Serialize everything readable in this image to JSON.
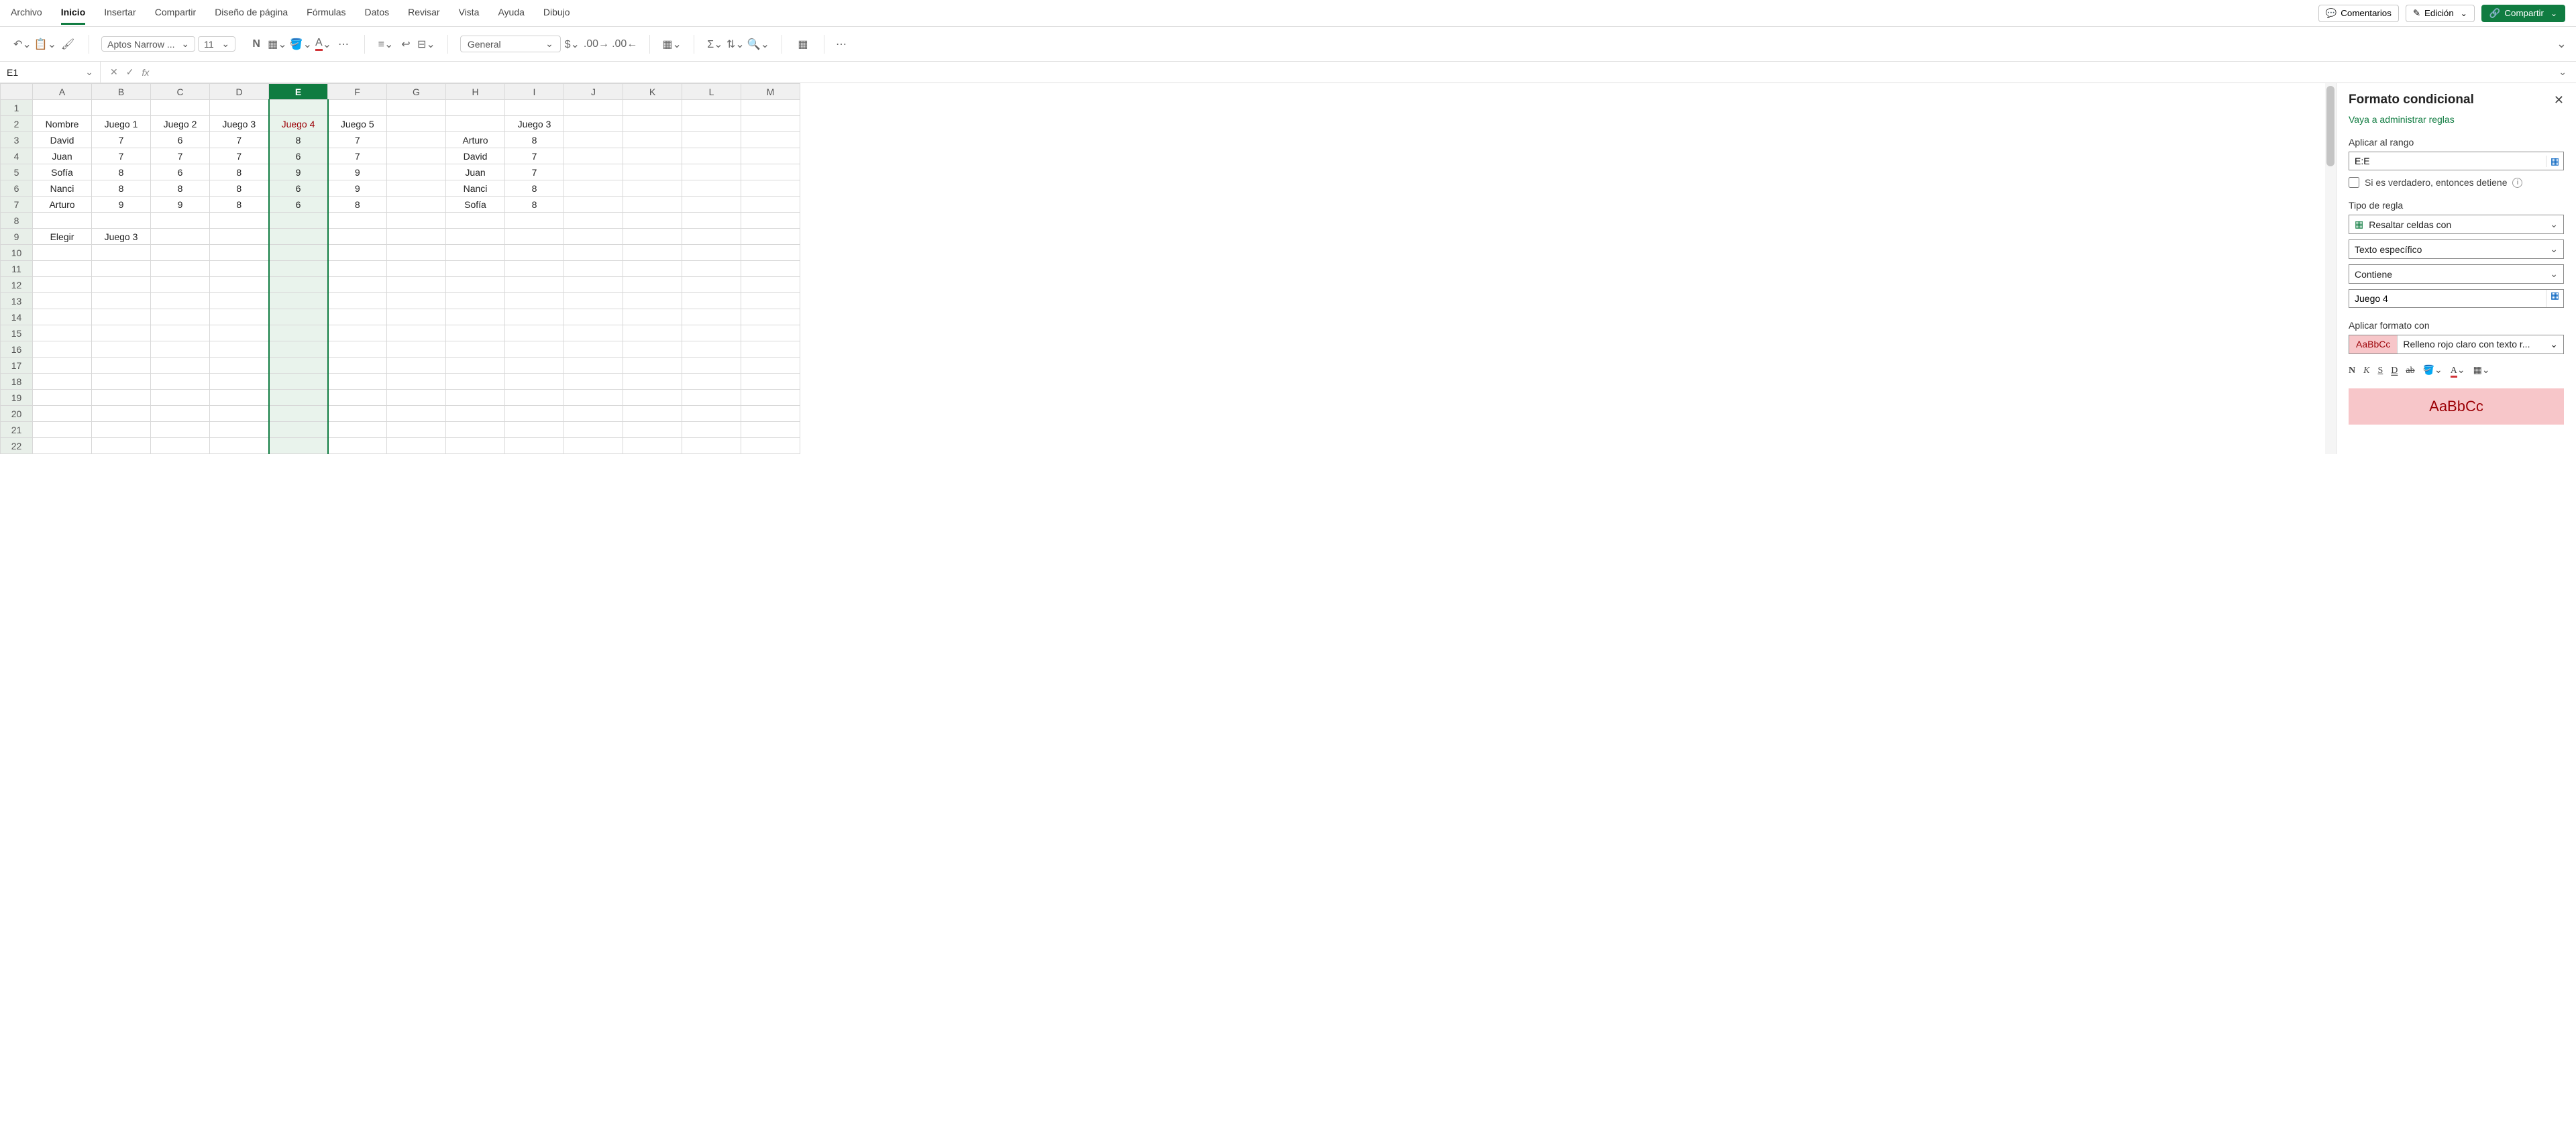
{
  "menu": {
    "items": [
      "Archivo",
      "Inicio",
      "Insertar",
      "Compartir",
      "Diseño de página",
      "Fórmulas",
      "Datos",
      "Revisar",
      "Vista",
      "Ayuda",
      "Dibujo"
    ],
    "active_index": 1,
    "comments": "Comentarios",
    "editing": "Edición",
    "share": "Compartir"
  },
  "ribbon": {
    "font_name": "Aptos Narrow ...",
    "font_size": "11",
    "number_format": "General"
  },
  "name_box": "E1",
  "formula": "",
  "grid": {
    "columns": [
      "A",
      "B",
      "C",
      "D",
      "E",
      "F",
      "G",
      "H",
      "I",
      "J",
      "K",
      "L",
      "M"
    ],
    "selected_column": "E",
    "row_count": 22,
    "highlight": {
      "r": 2,
      "c": "E"
    },
    "cells": {
      "2": {
        "A": "Nombre",
        "B": "Juego 1",
        "C": "Juego 2",
        "D": "Juego 3",
        "E": "Juego 4",
        "F": "Juego 5",
        "H": "",
        "I": "Juego 3"
      },
      "3": {
        "A": "David",
        "B": "7",
        "C": "6",
        "D": "7",
        "E": "8",
        "F": "7",
        "H": "Arturo",
        "I": "8"
      },
      "4": {
        "A": "Juan",
        "B": "7",
        "C": "7",
        "D": "7",
        "E": "6",
        "F": "7",
        "H": "David",
        "I": "7"
      },
      "5": {
        "A": "Sofía",
        "B": "8",
        "C": "6",
        "D": "8",
        "E": "9",
        "F": "9",
        "H": "Juan",
        "I": "7"
      },
      "6": {
        "A": "Nanci",
        "B": "8",
        "C": "8",
        "D": "8",
        "E": "6",
        "F": "9",
        "H": "Nanci",
        "I": "8"
      },
      "7": {
        "A": "Arturo",
        "B": "9",
        "C": "9",
        "D": "8",
        "E": "6",
        "F": "8",
        "H": "Sofía",
        "I": "8"
      },
      "9": {
        "A": "Elegir",
        "B": "Juego 3"
      }
    }
  },
  "panel": {
    "title": "Formato condicional",
    "manage_link": "Vaya a administrar reglas",
    "apply_range_label": "Aplicar al rango",
    "apply_range_value": "E:E",
    "stop_if_true": "Si es verdadero, entonces detiene",
    "rule_type_label": "Tipo de regla",
    "rule_type_value": "Resaltar celdas con",
    "subrule1": "Texto específico",
    "subrule2": "Contiene",
    "text_value": "Juego 4",
    "apply_format_label": "Aplicar formato con",
    "swatch_text": "AaBbCc",
    "format_preset": "Relleno rojo claro con texto r...",
    "preview": "AaBbCc"
  }
}
